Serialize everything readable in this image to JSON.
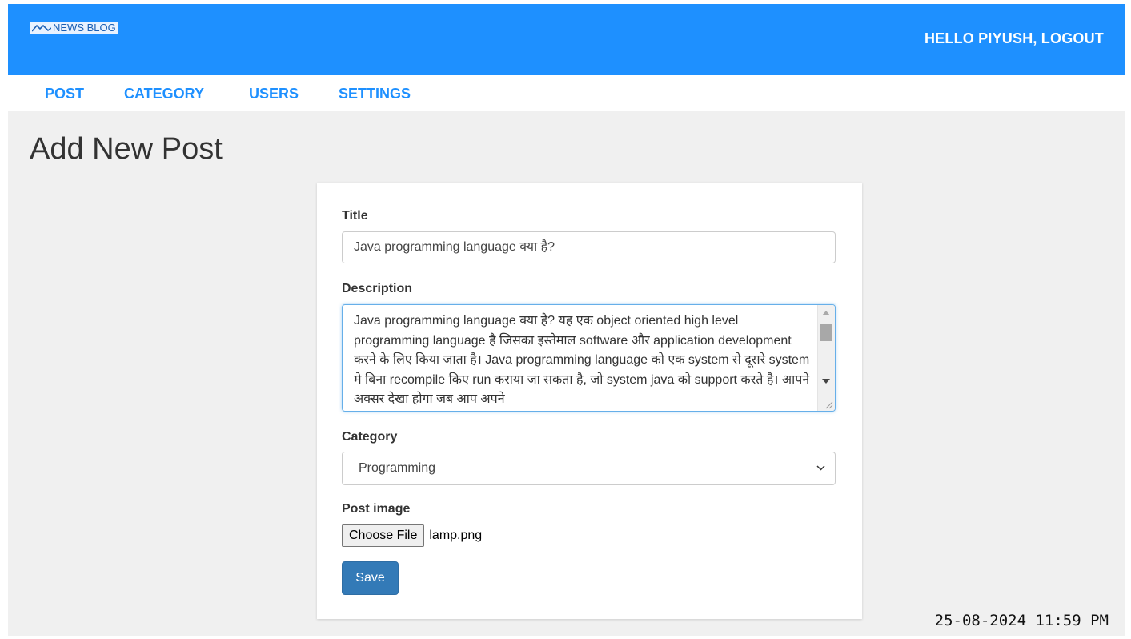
{
  "header": {
    "logo_text": "NEWS BLOG",
    "greeting": "HELLO PIYUSH, LOGOUT",
    "background_color": "#1e90ff"
  },
  "nav": {
    "items": [
      {
        "label": "POST"
      },
      {
        "label": "CATEGORY"
      },
      {
        "label": "USERS"
      },
      {
        "label": "SETTINGS"
      }
    ],
    "link_color": "#1e90ff"
  },
  "page": {
    "title": "Add New Post"
  },
  "form": {
    "title_label": "Title",
    "title_value": "Java programming language क्या है?",
    "description_label": "Description",
    "description_value": "Java programming language क्या है? यह एक object oriented high level programming language है जिसका इस्तेमाल software और application development करने के लिए किया जाता है। Java programming language को एक system से दूसरे system मे बिना recompile किए run कराया जा सकता है, जो system java को support करते है। आपने अक्सर देखा होगा जब आप अपने",
    "category_label": "Category",
    "category_value": "Programming",
    "image_label": "Post image",
    "file_button_label": "Choose File",
    "file_name": "lamp.png",
    "save_label": "Save",
    "save_color": "#337ab7"
  },
  "footer": {
    "timestamp": "25-08-2024 11:59 PM"
  }
}
